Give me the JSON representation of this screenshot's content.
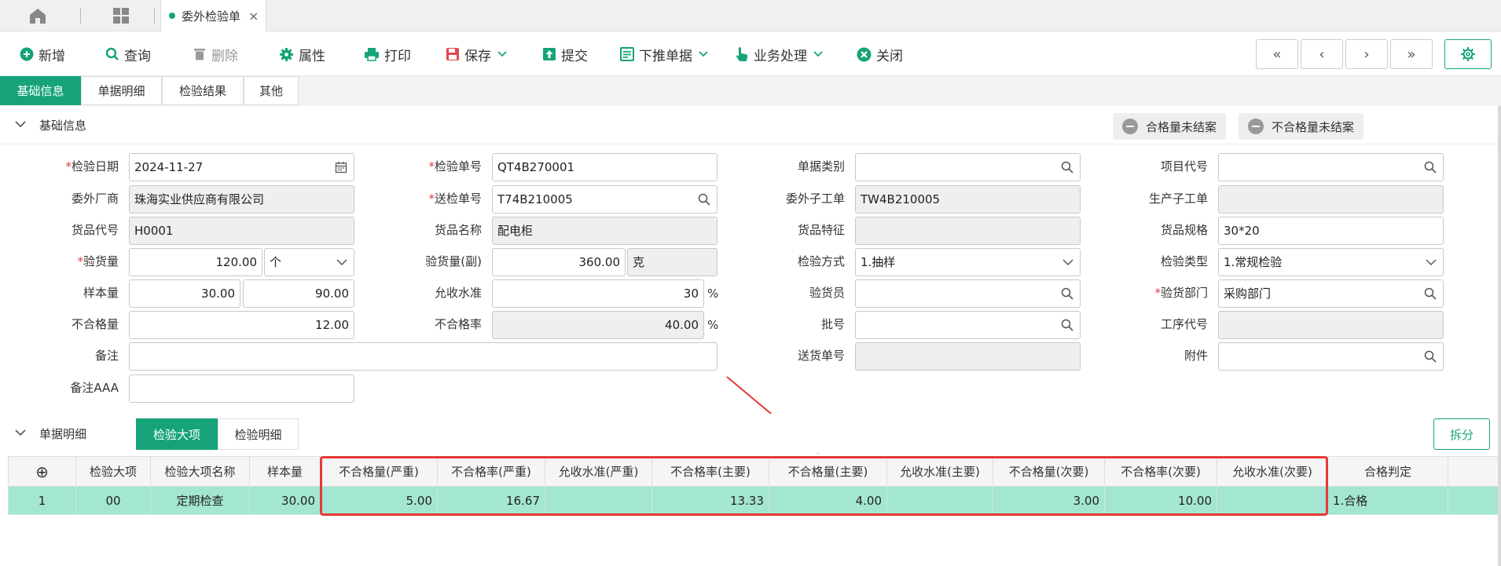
{
  "tabs": {
    "active_doc": "委外检验单"
  },
  "toolbar": {
    "new": "新增",
    "query": "查询",
    "delete": "删除",
    "props": "属性",
    "print": "打印",
    "save": "保存",
    "submit": "提交",
    "push_down": "下推单据",
    "business": "业务处理",
    "close": "关闭",
    "nav_first": "«",
    "nav_prev": "‹",
    "nav_next": "›",
    "nav_last": "»"
  },
  "section_tabs": [
    "基础信息",
    "单据明细",
    "检验结果",
    "其他"
  ],
  "basic_section": {
    "title": "基础信息",
    "pill_qualified": "合格量未结案",
    "pill_unqualified": "不合格量未结案"
  },
  "form": {
    "inspect_date": {
      "label": "检验日期",
      "value": "2024-11-27"
    },
    "inspect_no": {
      "label": "检验单号",
      "value": "QT4B270001"
    },
    "doc_category": {
      "label": "单据类别",
      "value": ""
    },
    "project_code": {
      "label": "项目代号",
      "value": ""
    },
    "vendor": {
      "label": "委外厂商",
      "value": "珠海实业供应商有限公司"
    },
    "send_no": {
      "label": "送检单号",
      "value": "T74B210005"
    },
    "sub_order": {
      "label": "委外子工单",
      "value": "TW4B210005"
    },
    "prod_sub_order": {
      "label": "生产子工单",
      "value": ""
    },
    "goods_code": {
      "label": "货品代号",
      "value": "H0001"
    },
    "goods_name": {
      "label": "货品名称",
      "value": "配电柜"
    },
    "goods_feature": {
      "label": "货品特征",
      "value": ""
    },
    "goods_spec": {
      "label": "货品规格",
      "value": "30*20"
    },
    "inspect_qty": {
      "label": "验货量",
      "value": "120.00",
      "unit": "个"
    },
    "inspect_qty_sub": {
      "label": "验货量(副)",
      "value": "360.00",
      "unit": "克"
    },
    "inspect_method": {
      "label": "检验方式",
      "value": "1.抽样"
    },
    "inspect_type": {
      "label": "检验类型",
      "value": "1.常规检验"
    },
    "sample_qty": {
      "label": "样本量",
      "value": "30.00",
      "value2": "90.00"
    },
    "aql": {
      "label": "允收水准",
      "value": "30",
      "pct": "%"
    },
    "inspector": {
      "label": "验货员",
      "value": ""
    },
    "inspect_dept": {
      "label": "验货部门",
      "value": "采购部门"
    },
    "unqualified_qty": {
      "label": "不合格量",
      "value": "12.00"
    },
    "unqualified_rate": {
      "label": "不合格率",
      "value": "40.00",
      "pct": "%"
    },
    "batch_no": {
      "label": "批号",
      "value": ""
    },
    "process_code": {
      "label": "工序代号",
      "value": ""
    },
    "remark": {
      "label": "备注",
      "value": ""
    },
    "delivery_no": {
      "label": "送货单号",
      "value": ""
    },
    "attachment": {
      "label": "附件",
      "value": ""
    },
    "remark_aaa": {
      "label": "备注AAA",
      "value": ""
    }
  },
  "detail_section": {
    "title": "单据明细",
    "tab_major": "检验大项",
    "tab_detail": "检验明细",
    "split": "拆分"
  },
  "table": {
    "add_symbol": "⊕",
    "headers": [
      "检验大项",
      "检验大项名称",
      "样本量",
      "不合格量(严重)",
      "不合格率(严重)",
      "允收水准(严重)",
      "不合格率(主要)",
      "不合格量(主要)",
      "允收水准(主要)",
      "不合格量(次要)",
      "不合格率(次要)",
      "允收水准(次要)",
      "合格判定"
    ],
    "rows": [
      [
        "1",
        "00",
        "定期检查",
        "30.00",
        "5.00",
        "16.67",
        "",
        "13.33",
        "4.00",
        "",
        "3.00",
        "10.00",
        "",
        "1.合格"
      ]
    ]
  }
}
